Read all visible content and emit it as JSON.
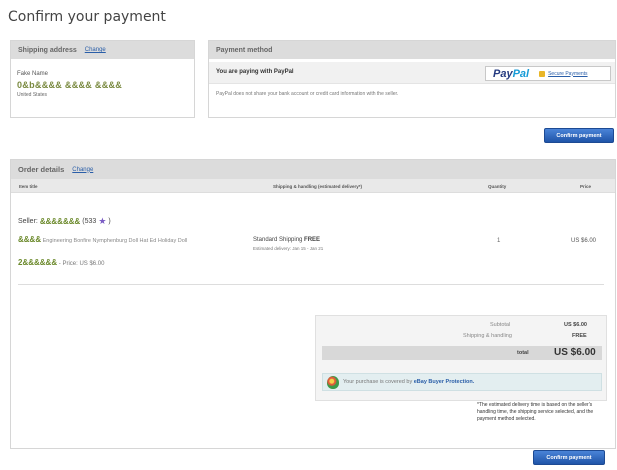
{
  "page": {
    "title": "Confirm your payment"
  },
  "shipping": {
    "heading": "Shipping address",
    "change": "Change",
    "name": "Fake Name",
    "address": "0&b&&&& &&&& &&&&",
    "city_line": "United States"
  },
  "payment": {
    "heading": "Payment method",
    "paying_with": "You are paying with PayPal",
    "paypal_logo": {
      "part1": "Pay",
      "part2": "Pal"
    },
    "secure": "Secure Payments",
    "note": "PayPal does not share your bank account or credit card information with the seller."
  },
  "buttons": {
    "confirm_top": "Confirm payment",
    "confirm_bottom": "Confirm payment"
  },
  "order": {
    "heading": "Order details",
    "change": "Change",
    "columns": {
      "item": "Item title",
      "shipping": "Shipping & handling (estimated delivery*)",
      "quantity": "Quantity",
      "price": "Price"
    },
    "seller_label": "Seller:",
    "seller_name": "&&&&&&&",
    "seller_feedback": "(533",
    "seller_feedback_end": ")",
    "item_title_blur": "&&&&",
    "item_title_text": "Engineering Bonfire Nymphenburg Doll Hat Ed Holiday Doll",
    "item_id_blur": "2&&&&&&",
    "item_price": "- Price: US $6.00",
    "shipping_method": "Standard Shipping",
    "shipping_cost": "FREE",
    "shipping_est": "Estimated delivery: Jan 15 - Jan 21",
    "quantity": "1",
    "price": "US $6.00"
  },
  "summary": {
    "subtotal_label": "Subtotal",
    "subtotal": "US $6.00",
    "shipping_label": "Shipping & handling",
    "shipping": "FREE",
    "total_label": "total",
    "total": "US $6.00",
    "protection_text": "Your purchase is covered by",
    "protection_link": "eBay Buyer Protection."
  },
  "delivery_note": "*The estimated delivery time is based on the seller's handling time, the shipping service selected, and the payment method selected."
}
